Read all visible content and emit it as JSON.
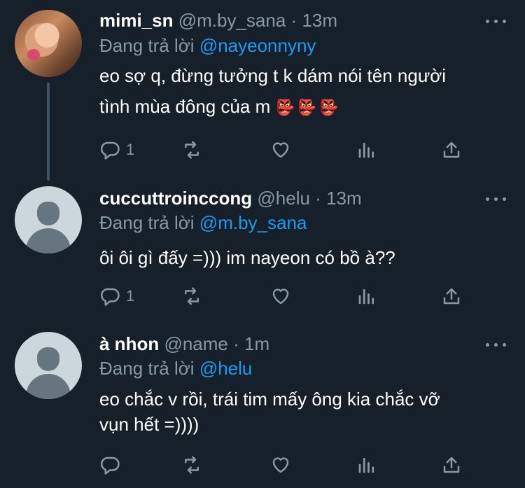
{
  "tweets": [
    {
      "name": "mimi_sn",
      "handle": "@m.by_sana",
      "separator": "·",
      "time": "13m",
      "reply_prefix": "Đang trả lời",
      "reply_to": "@nayeonnyny",
      "text_line1": "eo sợ q, đừng tưởng t k dám nói tên người",
      "text_line2": "tình mùa đông của m",
      "emoji": "👺👺👺",
      "reply_count": "1",
      "avatar": "profile-photo"
    },
    {
      "name": "cuccuttroinccong",
      "handle": "@helu",
      "separator": "·",
      "time": "13m",
      "reply_prefix": "Đang trả lời",
      "reply_to": "@m.by_sana",
      "text_line1": "ôi ôi gì đấy =))) im nayeon có bồ à??",
      "reply_count": "1",
      "avatar": "default-avatar"
    },
    {
      "name": "à nhon",
      "handle": "@name",
      "separator": "·",
      "time": "1m",
      "reply_prefix": "Đang trả lời",
      "reply_to": "@helu",
      "text_line1": "eo chắc v rồi, trái tim mấy ông kia chắc vỡ",
      "text_line2": "vụn hết =))))",
      "reply_count": "",
      "avatar": "default-avatar"
    }
  ],
  "icons": {
    "reply": "reply-icon",
    "retweet": "retweet-icon",
    "like": "heart-icon",
    "analytics": "analytics-icon",
    "share": "share-icon",
    "more": "more-icon"
  },
  "colors": {
    "background": "#15202b",
    "secondary_text": "#8899a6",
    "mention": "#1d9bf0",
    "thread_line": "#3d5466"
  }
}
